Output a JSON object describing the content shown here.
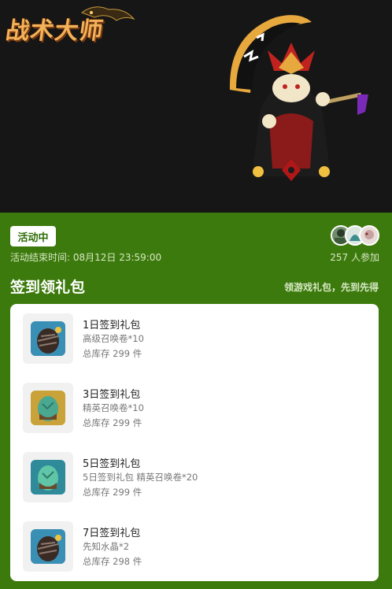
{
  "banner": {
    "logo_text": "战术大师"
  },
  "event": {
    "status": "活动中",
    "end_time": "活动结束时间: 08月12日 23:59:00",
    "participants": "257 人参加"
  },
  "section": {
    "title": "签到领礼包",
    "subtitle": "领游戏礼包，先到先得"
  },
  "gifts": [
    {
      "name": "1日签到礼包",
      "desc": "高级召唤卷*10",
      "stock": "总库存 299 件",
      "icon": "dark-egg-icon"
    },
    {
      "name": "3日签到礼包",
      "desc": "精英召唤卷*10",
      "stock": "总库存 299 件",
      "icon": "gold-egg-icon"
    },
    {
      "name": "5日签到礼包",
      "desc": "5日签到礼包 精英召唤卷*20",
      "stock": "总库存 299 件",
      "icon": "teal-egg-icon"
    },
    {
      "name": "7日签到礼包",
      "desc": "先知水晶*2",
      "stock": "总库存 298 件",
      "icon": "dark-egg-icon"
    }
  ],
  "colors": {
    "page_green": "#3d7a0d",
    "badge_text": "#2e6d08",
    "banner_bg": "#161616"
  }
}
